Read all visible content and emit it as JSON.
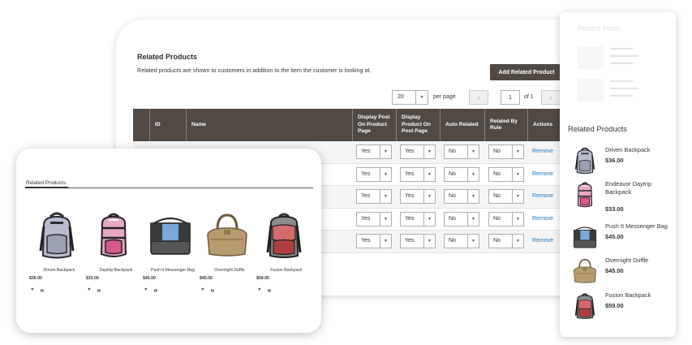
{
  "admin": {
    "title": "Related Products",
    "description": "Related products are shown to customers in addition to the item the customer is looking at.",
    "add_button": "Add Related Product",
    "per_page_value": "20",
    "per_page_label": "per page",
    "current_page": "1",
    "of_label": "of 1",
    "columns": [
      "ID",
      "Name",
      "Display Post On Product Page",
      "Display Product On Post Page",
      "Auto Related",
      "Related By Rule",
      "Actions"
    ],
    "rows": [
      {
        "display_post": "Yes",
        "display_product": "Yes",
        "auto": "No",
        "rule": "No",
        "action": "Remove"
      },
      {
        "display_post": "Yes",
        "display_product": "Yes",
        "auto": "No",
        "rule": "No",
        "action": "Remove"
      },
      {
        "display_post": "Yes",
        "display_product": "Yes",
        "auto": "No",
        "rule": "No",
        "action": "Remove"
      },
      {
        "display_post": "Yes",
        "display_product": "Yes",
        "auto": "No",
        "rule": "No",
        "action": "Remove"
      },
      {
        "display_post": "Yes",
        "display_product": "Yes",
        "auto": "No",
        "rule": "No",
        "action": "Remove"
      }
    ]
  },
  "sidebar": {
    "recent_posts_title": "Recent Posts",
    "title": "Related Products",
    "items": [
      {
        "name": "Driven Backpack",
        "price": "$36.00"
      },
      {
        "name": "Endeavor Daytrip Backpack",
        "price": "$33.00"
      },
      {
        "name": "Push It Messenger Bag",
        "price": "$45.00"
      },
      {
        "name": "Overnight Duffle",
        "price": "$45.00"
      },
      {
        "name": "Fusion Backpack",
        "price": "$59.00"
      }
    ]
  },
  "front": {
    "title": "Related Products",
    "products": [
      {
        "name": "Driven Backpack",
        "price": "$36.00"
      },
      {
        "name": "Daytrip Backpack",
        "price": "$33.00"
      },
      {
        "name": "Push It Messenger Bag",
        "price": "$45.00"
      },
      {
        "name": "Overnight Duffle",
        "price": "$45.00"
      },
      {
        "name": "Fusion Backpack",
        "price": "$59.00"
      }
    ]
  },
  "colors": {
    "grid_header": "#514943",
    "link": "#1979c3",
    "button": "#514943"
  },
  "icons": [
    "wishlist-heart-icon",
    "compare-icon",
    "dropdown-arrow-icon"
  ]
}
